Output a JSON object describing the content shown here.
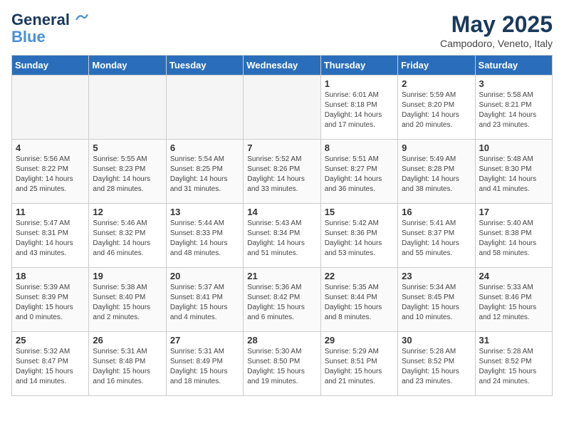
{
  "logo": {
    "line1": "General",
    "line2": "Blue"
  },
  "title": "May 2025",
  "location": "Campodoro, Veneto, Italy",
  "weekdays": [
    "Sunday",
    "Monday",
    "Tuesday",
    "Wednesday",
    "Thursday",
    "Friday",
    "Saturday"
  ],
  "weeks": [
    [
      {
        "day": "",
        "info": ""
      },
      {
        "day": "",
        "info": ""
      },
      {
        "day": "",
        "info": ""
      },
      {
        "day": "",
        "info": ""
      },
      {
        "day": "1",
        "info": "Sunrise: 6:01 AM\nSunset: 8:18 PM\nDaylight: 14 hours\nand 17 minutes."
      },
      {
        "day": "2",
        "info": "Sunrise: 5:59 AM\nSunset: 8:20 PM\nDaylight: 14 hours\nand 20 minutes."
      },
      {
        "day": "3",
        "info": "Sunrise: 5:58 AM\nSunset: 8:21 PM\nDaylight: 14 hours\nand 23 minutes."
      }
    ],
    [
      {
        "day": "4",
        "info": "Sunrise: 5:56 AM\nSunset: 8:22 PM\nDaylight: 14 hours\nand 25 minutes."
      },
      {
        "day": "5",
        "info": "Sunrise: 5:55 AM\nSunset: 8:23 PM\nDaylight: 14 hours\nand 28 minutes."
      },
      {
        "day": "6",
        "info": "Sunrise: 5:54 AM\nSunset: 8:25 PM\nDaylight: 14 hours\nand 31 minutes."
      },
      {
        "day": "7",
        "info": "Sunrise: 5:52 AM\nSunset: 8:26 PM\nDaylight: 14 hours\nand 33 minutes."
      },
      {
        "day": "8",
        "info": "Sunrise: 5:51 AM\nSunset: 8:27 PM\nDaylight: 14 hours\nand 36 minutes."
      },
      {
        "day": "9",
        "info": "Sunrise: 5:49 AM\nSunset: 8:28 PM\nDaylight: 14 hours\nand 38 minutes."
      },
      {
        "day": "10",
        "info": "Sunrise: 5:48 AM\nSunset: 8:30 PM\nDaylight: 14 hours\nand 41 minutes."
      }
    ],
    [
      {
        "day": "11",
        "info": "Sunrise: 5:47 AM\nSunset: 8:31 PM\nDaylight: 14 hours\nand 43 minutes."
      },
      {
        "day": "12",
        "info": "Sunrise: 5:46 AM\nSunset: 8:32 PM\nDaylight: 14 hours\nand 46 minutes."
      },
      {
        "day": "13",
        "info": "Sunrise: 5:44 AM\nSunset: 8:33 PM\nDaylight: 14 hours\nand 48 minutes."
      },
      {
        "day": "14",
        "info": "Sunrise: 5:43 AM\nSunset: 8:34 PM\nDaylight: 14 hours\nand 51 minutes."
      },
      {
        "day": "15",
        "info": "Sunrise: 5:42 AM\nSunset: 8:36 PM\nDaylight: 14 hours\nand 53 minutes."
      },
      {
        "day": "16",
        "info": "Sunrise: 5:41 AM\nSunset: 8:37 PM\nDaylight: 14 hours\nand 55 minutes."
      },
      {
        "day": "17",
        "info": "Sunrise: 5:40 AM\nSunset: 8:38 PM\nDaylight: 14 hours\nand 58 minutes."
      }
    ],
    [
      {
        "day": "18",
        "info": "Sunrise: 5:39 AM\nSunset: 8:39 PM\nDaylight: 15 hours\nand 0 minutes."
      },
      {
        "day": "19",
        "info": "Sunrise: 5:38 AM\nSunset: 8:40 PM\nDaylight: 15 hours\nand 2 minutes."
      },
      {
        "day": "20",
        "info": "Sunrise: 5:37 AM\nSunset: 8:41 PM\nDaylight: 15 hours\nand 4 minutes."
      },
      {
        "day": "21",
        "info": "Sunrise: 5:36 AM\nSunset: 8:42 PM\nDaylight: 15 hours\nand 6 minutes."
      },
      {
        "day": "22",
        "info": "Sunrise: 5:35 AM\nSunset: 8:44 PM\nDaylight: 15 hours\nand 8 minutes."
      },
      {
        "day": "23",
        "info": "Sunrise: 5:34 AM\nSunset: 8:45 PM\nDaylight: 15 hours\nand 10 minutes."
      },
      {
        "day": "24",
        "info": "Sunrise: 5:33 AM\nSunset: 8:46 PM\nDaylight: 15 hours\nand 12 minutes."
      }
    ],
    [
      {
        "day": "25",
        "info": "Sunrise: 5:32 AM\nSunset: 8:47 PM\nDaylight: 15 hours\nand 14 minutes."
      },
      {
        "day": "26",
        "info": "Sunrise: 5:31 AM\nSunset: 8:48 PM\nDaylight: 15 hours\nand 16 minutes."
      },
      {
        "day": "27",
        "info": "Sunrise: 5:31 AM\nSunset: 8:49 PM\nDaylight: 15 hours\nand 18 minutes."
      },
      {
        "day": "28",
        "info": "Sunrise: 5:30 AM\nSunset: 8:50 PM\nDaylight: 15 hours\nand 19 minutes."
      },
      {
        "day": "29",
        "info": "Sunrise: 5:29 AM\nSunset: 8:51 PM\nDaylight: 15 hours\nand 21 minutes."
      },
      {
        "day": "30",
        "info": "Sunrise: 5:28 AM\nSunset: 8:52 PM\nDaylight: 15 hours\nand 23 minutes."
      },
      {
        "day": "31",
        "info": "Sunrise: 5:28 AM\nSunset: 8:52 PM\nDaylight: 15 hours\nand 24 minutes."
      }
    ]
  ]
}
